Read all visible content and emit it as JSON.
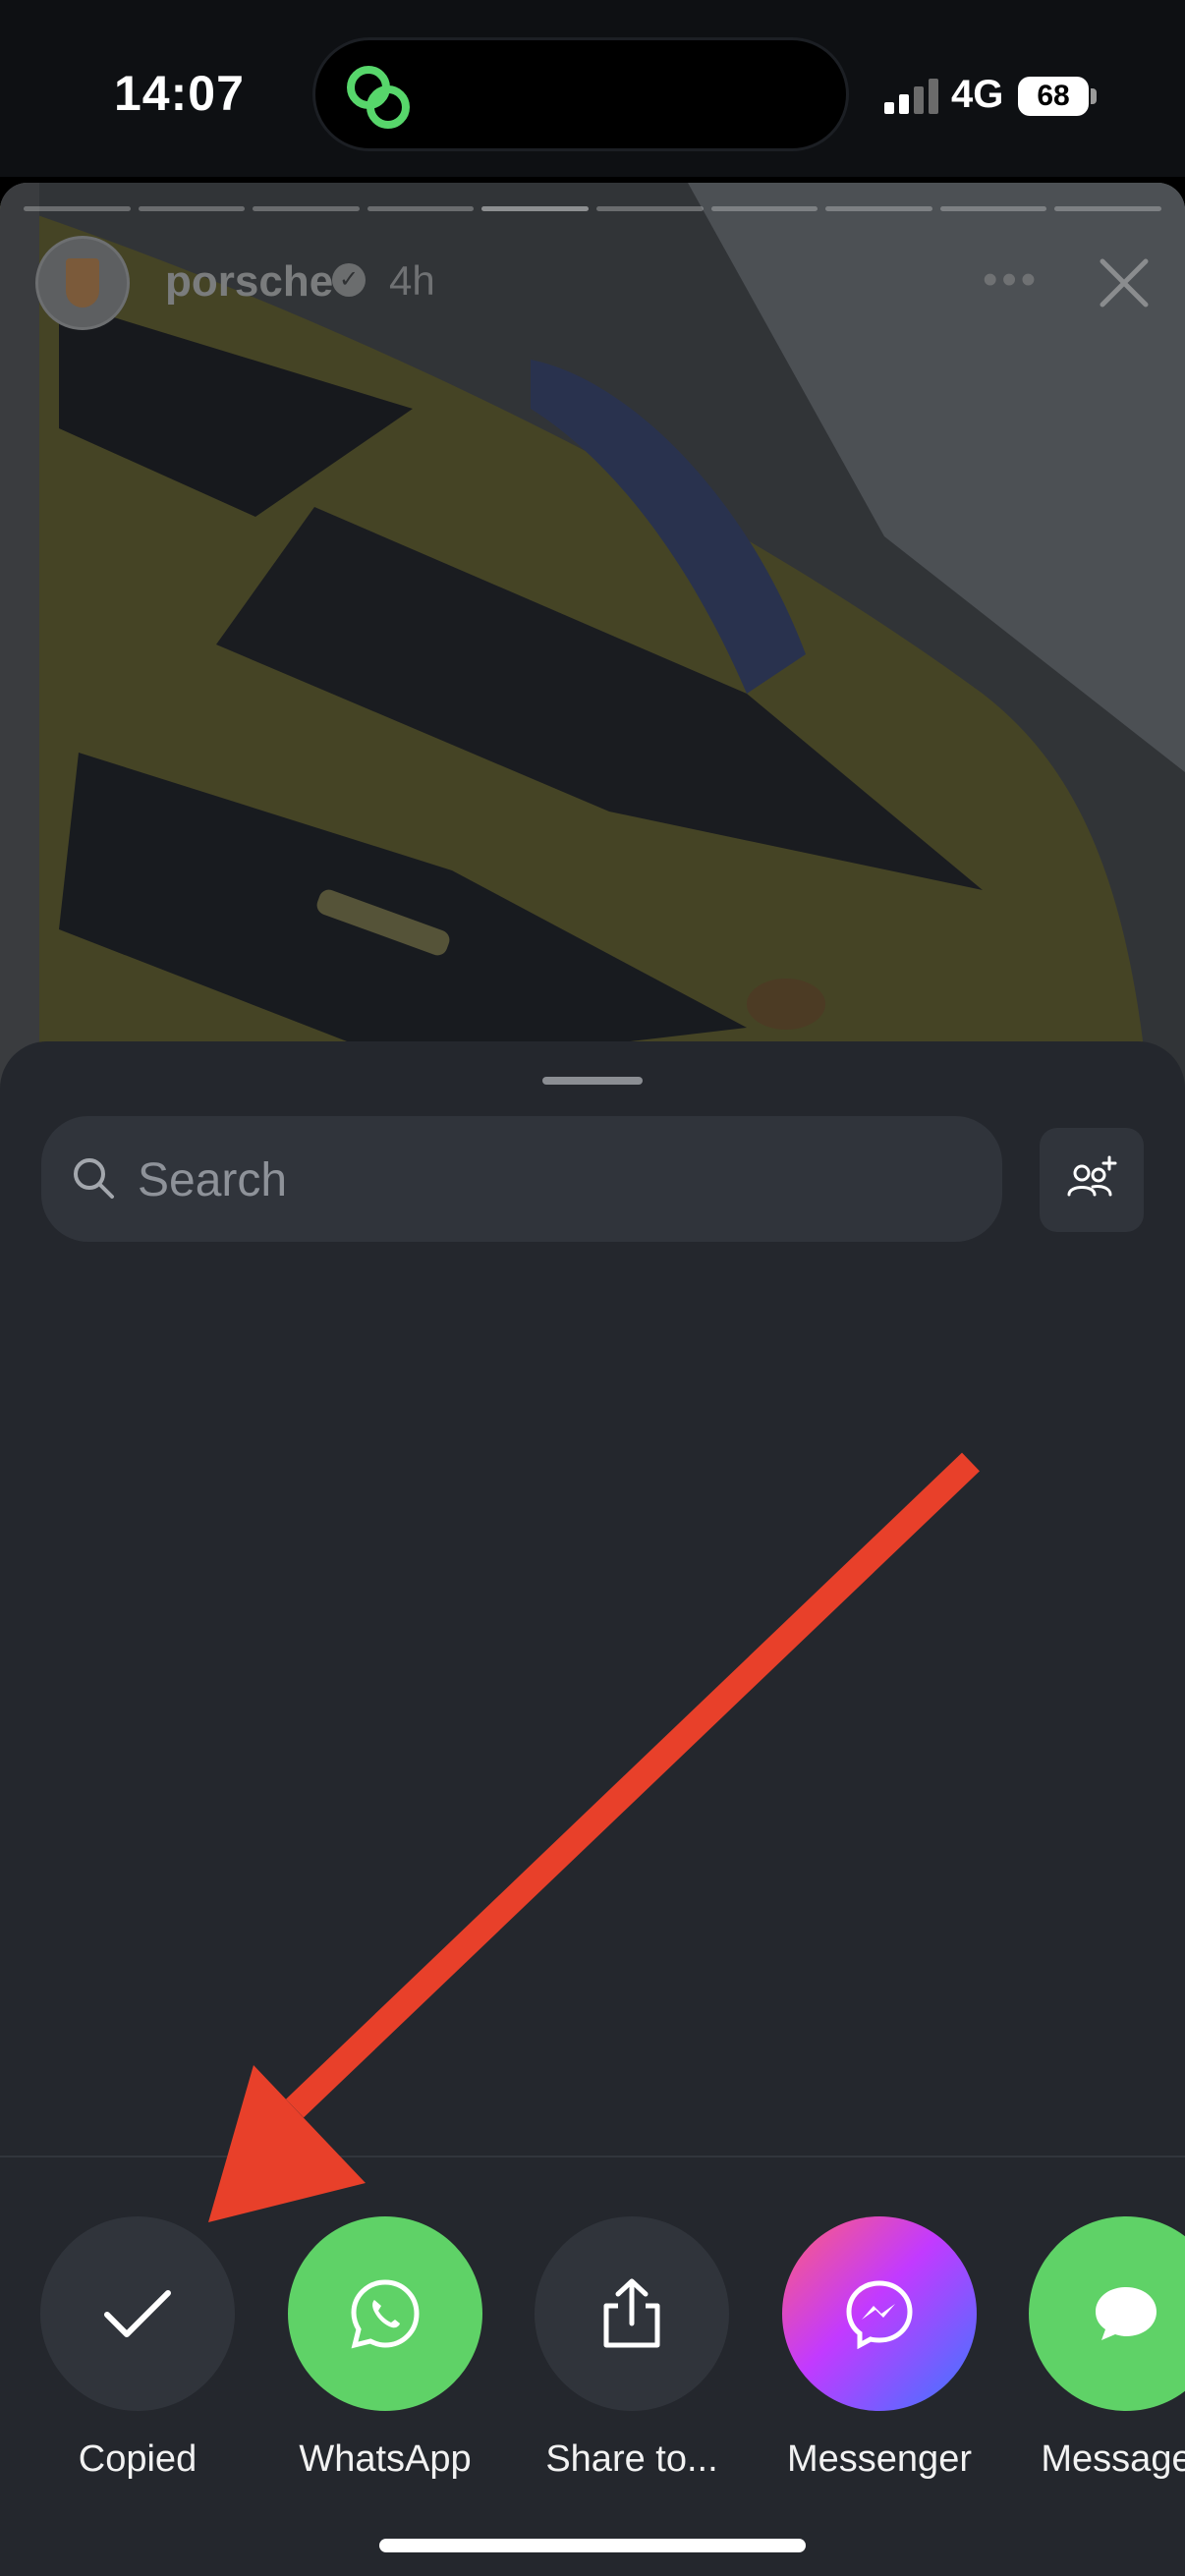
{
  "status_bar": {
    "time": "14:07",
    "network": "4G",
    "battery": "68",
    "island_icon": "link-circles-icon"
  },
  "story": {
    "username": "porsche",
    "time_ago": "4h",
    "more_icon": "more-dots-icon",
    "close_icon": "close-icon"
  },
  "share_sheet": {
    "search": {
      "placeholder": "Search",
      "value": ""
    },
    "add_people_icon": "add-people-icon",
    "actions": [
      {
        "label": "Copied",
        "icon": "checkmark-icon"
      },
      {
        "label": "WhatsApp",
        "icon": "whatsapp-icon"
      },
      {
        "label": "Share to...",
        "icon": "share-icon"
      },
      {
        "label": "Messenger",
        "icon": "messenger-icon"
      },
      {
        "label": "Messages",
        "icon": "messages-icon"
      }
    ]
  },
  "colors": {
    "sheet_bg": "#24272d",
    "whatsapp_green": "#5fd267",
    "annotation_arrow": "#e8402a"
  }
}
